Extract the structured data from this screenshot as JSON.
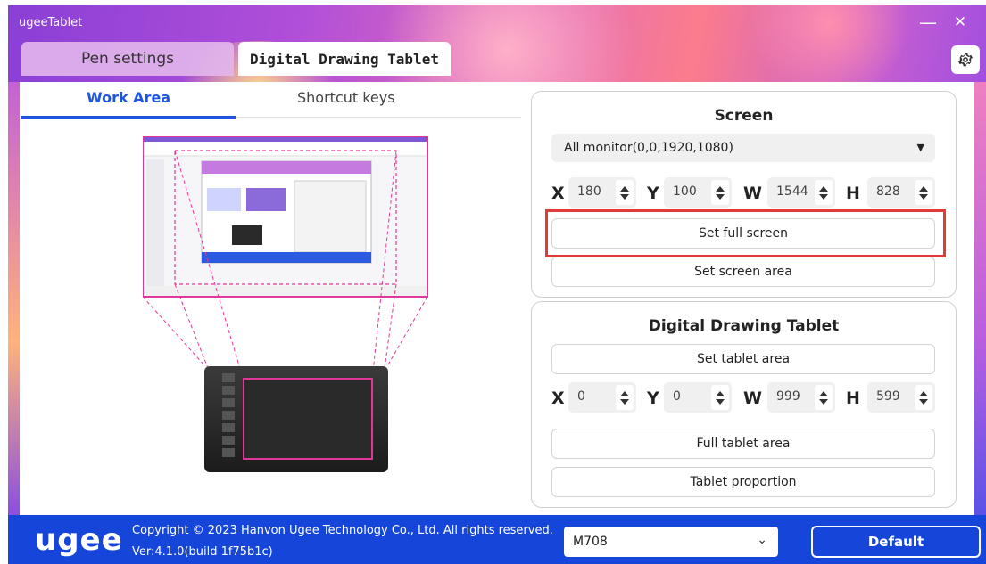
{
  "app": {
    "title": "ugeeTablet",
    "minimize": "—",
    "close": "✕"
  },
  "tabs": [
    {
      "label": "Pen settings",
      "active": false
    },
    {
      "label": "Digital Drawing Tablet",
      "active": true
    }
  ],
  "subtabs": [
    {
      "label": "Work Area",
      "active": true
    },
    {
      "label": "Shortcut keys",
      "active": false
    }
  ],
  "screen_panel": {
    "title": "Screen",
    "monitor_select": "All monitor(0,0,1920,1080)",
    "coords": [
      {
        "label": "X",
        "value": "180"
      },
      {
        "label": "Y",
        "value": "100"
      },
      {
        "label": "W",
        "value": "1544"
      },
      {
        "label": "H",
        "value": "828"
      }
    ],
    "set_full_screen": "Set full screen",
    "set_screen_area": "Set screen area"
  },
  "tablet_panel": {
    "title": "Digital Drawing Tablet",
    "set_tablet_area": "Set tablet area",
    "coords": [
      {
        "label": "X",
        "value": "0"
      },
      {
        "label": "Y",
        "value": "0"
      },
      {
        "label": "W",
        "value": "999"
      },
      {
        "label": "H",
        "value": "599"
      }
    ],
    "full_tablet_area": "Full tablet area",
    "tablet_proportion": "Tablet proportion"
  },
  "footer": {
    "logo": "ugee",
    "copyright": "Copyright © 2023 Hanvon Ugee Technology Co., Ltd. All rights reserved.",
    "version": "Ver:4.1.0(build 1f75b1c)",
    "model": "M708",
    "default_button": "Default"
  },
  "colors": {
    "accent": "#1f56e0",
    "footer": "#1646d9",
    "highlight": "#e23a3a",
    "area": "#e0389a"
  },
  "icons": {
    "settings": "gear-icon",
    "dropdown": "caret-down-icon",
    "model_dropdown": "chevron-down-icon"
  }
}
